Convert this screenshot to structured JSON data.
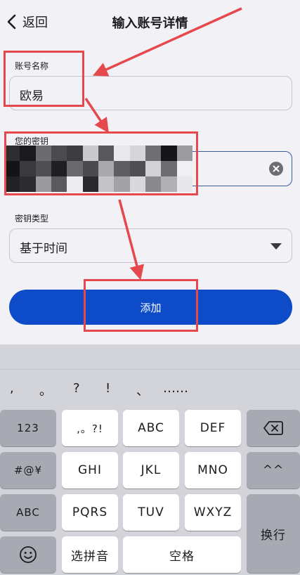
{
  "nav": {
    "back_label": "返回",
    "title": "输入账号详情"
  },
  "account_name": {
    "label": "账号名称",
    "value": "欧易"
  },
  "secret_key": {
    "label": "您的密钥"
  },
  "key_type": {
    "label": "密钥类型",
    "value": "基于时间"
  },
  "add_button": {
    "label": "添加"
  },
  "accent_colors": {
    "primary": "#0d4bc9",
    "annotation": "#e5484d"
  },
  "keyboard": {
    "punctuation": [
      ",",
      "。",
      "?",
      "!",
      "、",
      "……"
    ],
    "keys": {
      "num": "123",
      "symbols_abbr": ",。?!",
      "abc": "ABC",
      "def": "DEF",
      "sym": "#@¥",
      "ghi": "GHI",
      "jkl": "JKL",
      "mno": "MNO",
      "emoticon": "^^",
      "abc_switch": "ABC",
      "pqrs": "PQRS",
      "tuv": "TUV",
      "wxyz": "WXYZ",
      "pinyin": "选拼音",
      "space": "空格",
      "return": "换行"
    }
  }
}
